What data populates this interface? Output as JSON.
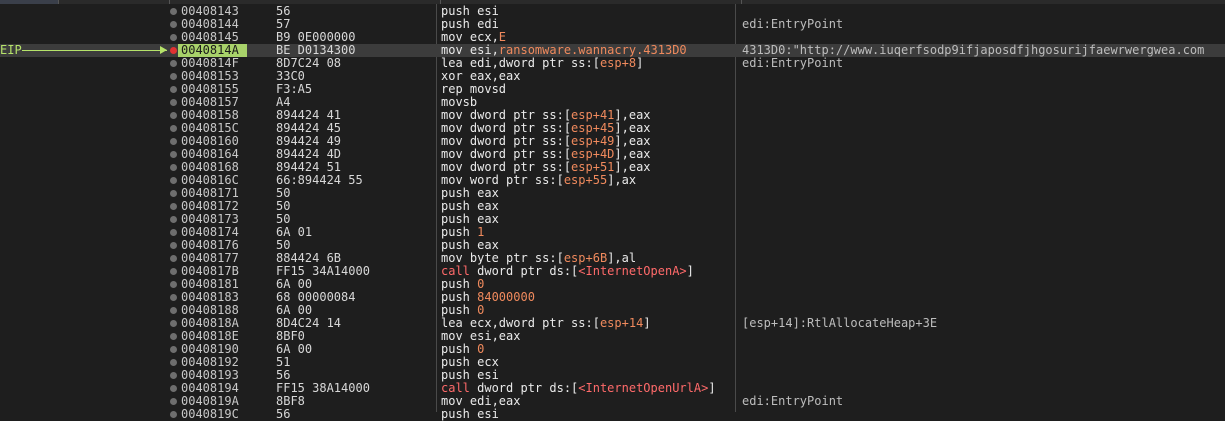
{
  "eip_label": "EIP",
  "eip_row_index": 3,
  "colors": {
    "background": "#1e1e1e",
    "eip_highlight": "#a8d26a",
    "breakpoint": "#e03232",
    "operand_accent": "#f08a5d",
    "api_call_accent": "#ff6a6a"
  },
  "rows": [
    {
      "addr": "00408143",
      "bytes": "56",
      "instr": [
        {
          "t": "push esi"
        }
      ],
      "comment": ""
    },
    {
      "addr": "00408144",
      "bytes": "57",
      "instr": [
        {
          "t": "push edi"
        }
      ],
      "comment": "edi:EntryPoint"
    },
    {
      "addr": "00408145",
      "bytes": "B9 0E000000",
      "instr": [
        {
          "t": "mov ecx,"
        },
        {
          "t": "E",
          "c": "orange"
        }
      ],
      "comment": ""
    },
    {
      "addr": "0040814A",
      "bytes": "BE D0134300",
      "instr": [
        {
          "t": "mov esi,"
        },
        {
          "t": "ransomware.wannacry.4313D0",
          "c": "orange"
        }
      ],
      "comment": "4313D0:\"http://www.iuqerfsodp9ifjaposdfjhgosurijfaewrwergwea.com"
    },
    {
      "addr": "0040814F",
      "bytes": "8D7C24 08",
      "instr": [
        {
          "t": "lea edi,dword ptr ss:["
        },
        {
          "t": "esp+8",
          "c": "orange"
        },
        {
          "t": "]"
        }
      ],
      "comment": "edi:EntryPoint"
    },
    {
      "addr": "00408153",
      "bytes": "33C0",
      "instr": [
        {
          "t": "xor eax,eax"
        }
      ],
      "comment": ""
    },
    {
      "addr": "00408155",
      "bytes": "F3:A5",
      "instr": [
        {
          "t": "rep movsd"
        }
      ],
      "comment": ""
    },
    {
      "addr": "00408157",
      "bytes": "A4",
      "instr": [
        {
          "t": "movsb"
        }
      ],
      "comment": ""
    },
    {
      "addr": "00408158",
      "bytes": "894424 41",
      "instr": [
        {
          "t": "mov dword ptr ss:["
        },
        {
          "t": "esp+41",
          "c": "orange"
        },
        {
          "t": "],eax"
        }
      ],
      "comment": ""
    },
    {
      "addr": "0040815C",
      "bytes": "894424 45",
      "instr": [
        {
          "t": "mov dword ptr ss:["
        },
        {
          "t": "esp+45",
          "c": "orange"
        },
        {
          "t": "],eax"
        }
      ],
      "comment": ""
    },
    {
      "addr": "00408160",
      "bytes": "894424 49",
      "instr": [
        {
          "t": "mov dword ptr ss:["
        },
        {
          "t": "esp+49",
          "c": "orange"
        },
        {
          "t": "],eax"
        }
      ],
      "comment": ""
    },
    {
      "addr": "00408164",
      "bytes": "894424 4D",
      "instr": [
        {
          "t": "mov dword ptr ss:["
        },
        {
          "t": "esp+4D",
          "c": "orange"
        },
        {
          "t": "],eax"
        }
      ],
      "comment": ""
    },
    {
      "addr": "00408168",
      "bytes": "894424 51",
      "instr": [
        {
          "t": "mov dword ptr ss:["
        },
        {
          "t": "esp+51",
          "c": "orange"
        },
        {
          "t": "],eax"
        }
      ],
      "comment": ""
    },
    {
      "addr": "0040816C",
      "bytes": "66:894424 55",
      "instr": [
        {
          "t": "mov word ptr ss:["
        },
        {
          "t": "esp+55",
          "c": "orange"
        },
        {
          "t": "],ax"
        }
      ],
      "comment": ""
    },
    {
      "addr": "00408171",
      "bytes": "50",
      "instr": [
        {
          "t": "push eax"
        }
      ],
      "comment": ""
    },
    {
      "addr": "00408172",
      "bytes": "50",
      "instr": [
        {
          "t": "push eax"
        }
      ],
      "comment": ""
    },
    {
      "addr": "00408173",
      "bytes": "50",
      "instr": [
        {
          "t": "push eax"
        }
      ],
      "comment": ""
    },
    {
      "addr": "00408174",
      "bytes": "6A 01",
      "instr": [
        {
          "t": "push "
        },
        {
          "t": "1",
          "c": "orange"
        }
      ],
      "comment": ""
    },
    {
      "addr": "00408176",
      "bytes": "50",
      "instr": [
        {
          "t": "push eax"
        }
      ],
      "comment": ""
    },
    {
      "addr": "00408177",
      "bytes": "884424 6B",
      "instr": [
        {
          "t": "mov byte ptr ss:["
        },
        {
          "t": "esp+6B",
          "c": "orange"
        },
        {
          "t": "],al"
        }
      ],
      "comment": ""
    },
    {
      "addr": "0040817B",
      "bytes": "FF15 34A14000",
      "instr": [
        {
          "t": "call",
          "c": "red"
        },
        {
          "t": " dword ptr ds:["
        },
        {
          "t": "<InternetOpenA>",
          "c": "red"
        },
        {
          "t": "]"
        }
      ],
      "comment": ""
    },
    {
      "addr": "00408181",
      "bytes": "6A 00",
      "instr": [
        {
          "t": "push "
        },
        {
          "t": "0",
          "c": "orange"
        }
      ],
      "comment": ""
    },
    {
      "addr": "00408183",
      "bytes": "68 00000084",
      "instr": [
        {
          "t": "push "
        },
        {
          "t": "84000000",
          "c": "orange"
        }
      ],
      "comment": ""
    },
    {
      "addr": "00408188",
      "bytes": "6A 00",
      "instr": [
        {
          "t": "push "
        },
        {
          "t": "0",
          "c": "orange"
        }
      ],
      "comment": ""
    },
    {
      "addr": "0040818A",
      "bytes": "8D4C24 14",
      "instr": [
        {
          "t": "lea ecx,dword ptr ss:["
        },
        {
          "t": "esp+14",
          "c": "orange"
        },
        {
          "t": "]"
        }
      ],
      "comment": "[esp+14]:RtlAllocateHeap+3E"
    },
    {
      "addr": "0040818E",
      "bytes": "8BF0",
      "instr": [
        {
          "t": "mov esi,eax"
        }
      ],
      "comment": ""
    },
    {
      "addr": "00408190",
      "bytes": "6A 00",
      "instr": [
        {
          "t": "push "
        },
        {
          "t": "0",
          "c": "orange"
        }
      ],
      "comment": ""
    },
    {
      "addr": "00408192",
      "bytes": "51",
      "instr": [
        {
          "t": "push ecx"
        }
      ],
      "comment": ""
    },
    {
      "addr": "00408193",
      "bytes": "56",
      "instr": [
        {
          "t": "push esi"
        }
      ],
      "comment": ""
    },
    {
      "addr": "00408194",
      "bytes": "FF15 38A14000",
      "instr": [
        {
          "t": "call",
          "c": "red"
        },
        {
          "t": " dword ptr ds:["
        },
        {
          "t": "<InternetOpenUrlA>",
          "c": "red"
        },
        {
          "t": "]"
        }
      ],
      "comment": ""
    },
    {
      "addr": "0040819A",
      "bytes": "8BF8",
      "instr": [
        {
          "t": "mov edi,eax"
        }
      ],
      "comment": "edi:EntryPoint"
    },
    {
      "addr": "0040819C",
      "bytes": "56",
      "instr": [
        {
          "t": "push esi"
        }
      ],
      "comment": ""
    }
  ]
}
